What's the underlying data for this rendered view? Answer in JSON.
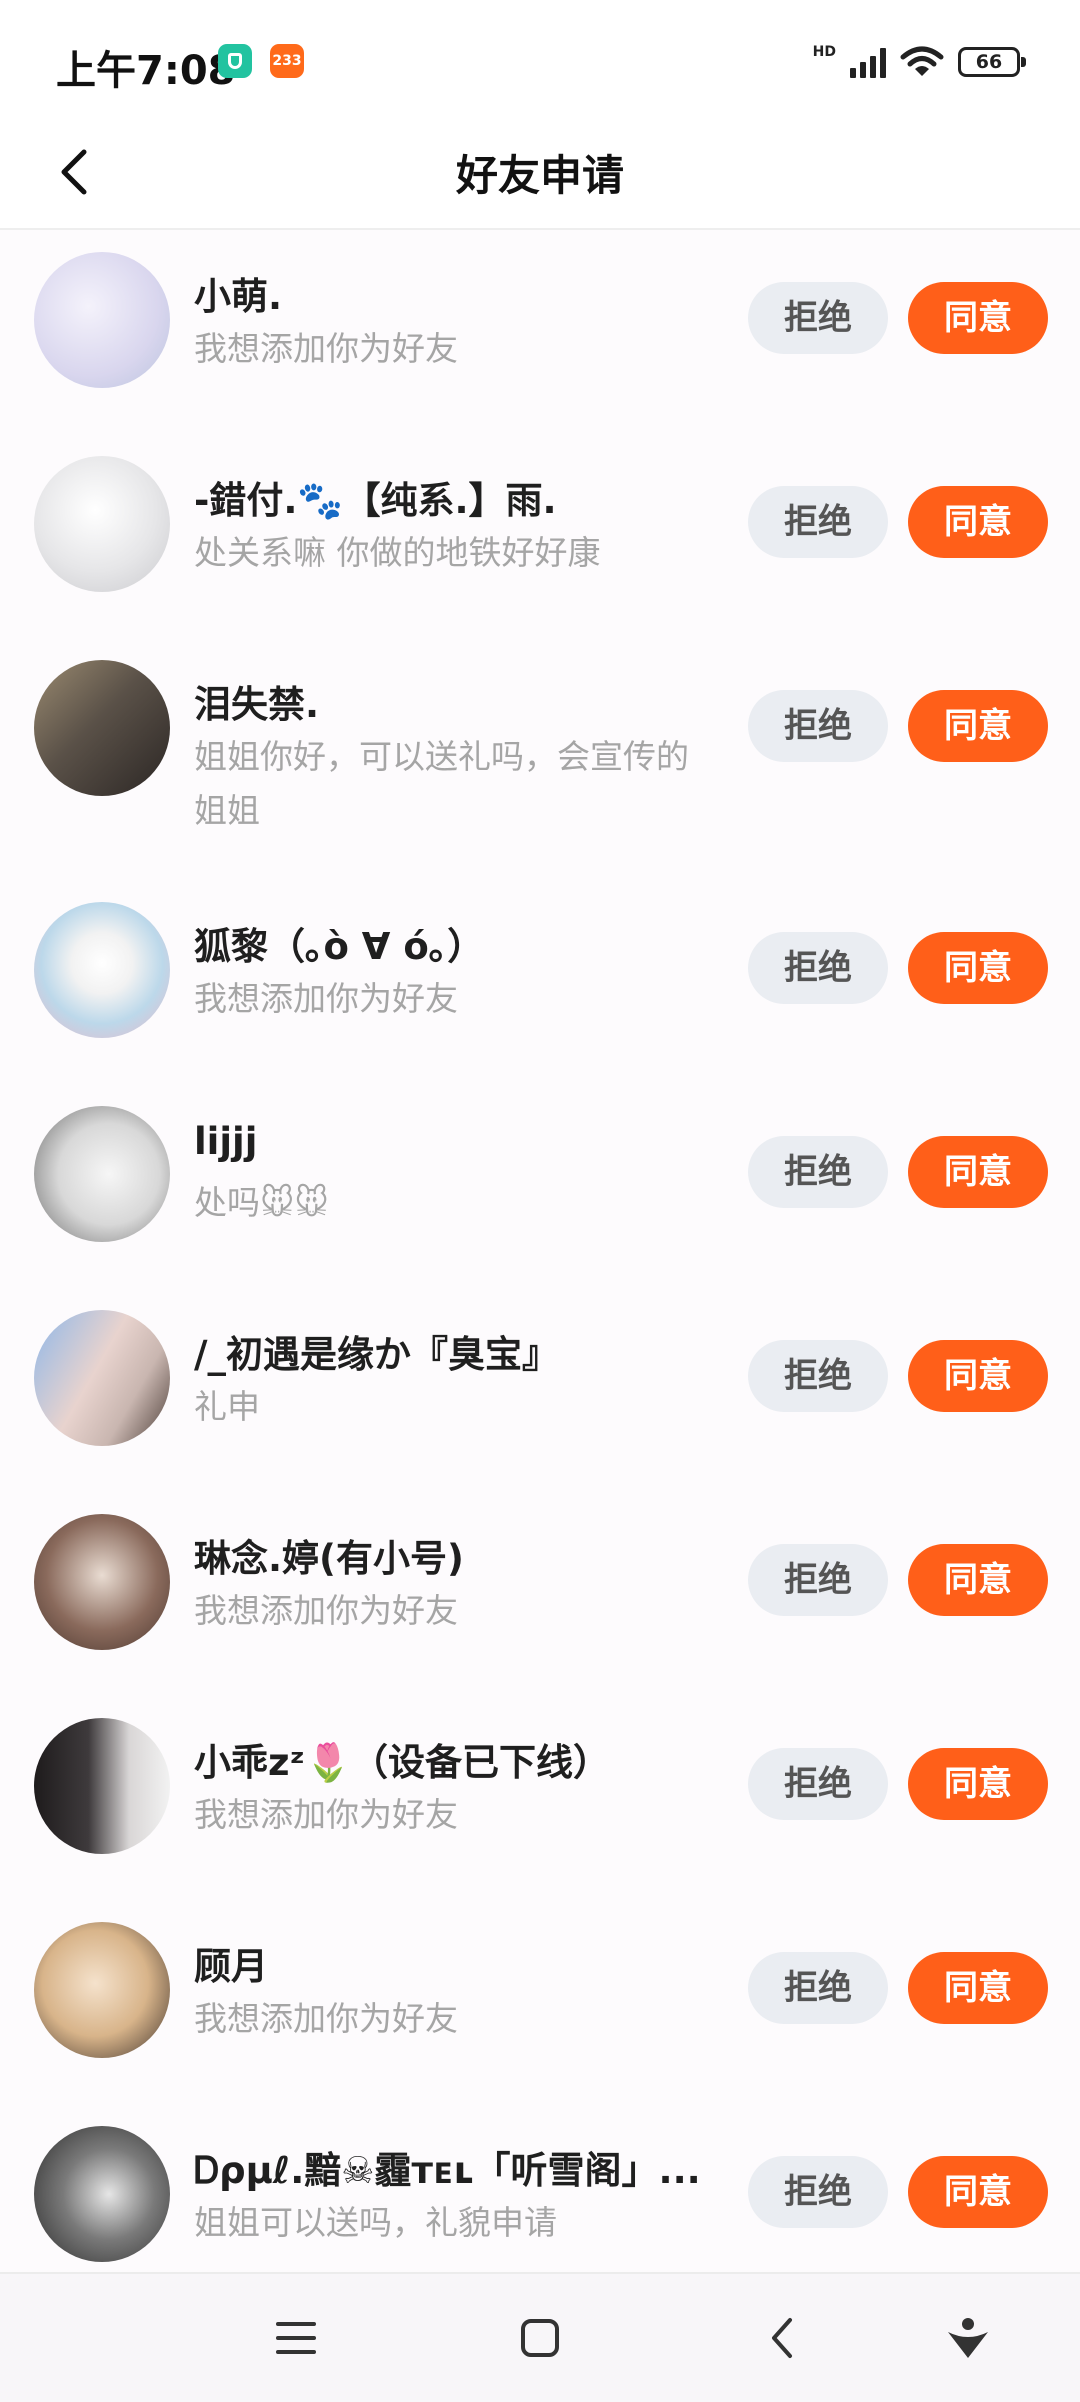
{
  "status_bar": {
    "time": "上午7:08",
    "badge_number": "233",
    "network": "HD",
    "battery": "66"
  },
  "header": {
    "title": "好友申请"
  },
  "buttons": {
    "reject": "拒绝",
    "accept": "同意"
  },
  "requests": [
    {
      "name": "小萌.",
      "message": "我想添加你为好友",
      "avatar_color": "#d9d6ee"
    },
    {
      "name": "-錯付.🐾【纯系.】雨.",
      "message": "处关系嘛 你做的地铁好好康",
      "avatar_color": "#e6e6e8"
    },
    {
      "name": "泪失禁.",
      "message": "姐姐你好，可以送礼吗，会宣传的姐姐",
      "avatar_color": "#5a5148"
    },
    {
      "name": "狐黎（｡ò ∀ ó｡）",
      "message": "我想添加你为好友",
      "avatar_color": "#bcd8ea"
    },
    {
      "name": "lijjj",
      "message": "处吗🐭🐭",
      "avatar_color": "#d8d8d8"
    },
    {
      "name": "/_初遇是缘か『臭宝』",
      "message": "礼申",
      "avatar_color": "#c9b6b0"
    },
    {
      "name": "琳念.婷(有小号)",
      "message": "我想添加你为好友",
      "avatar_color": "#8a6a5c"
    },
    {
      "name": "小乖zᶻ🌷（设备已下线）",
      "message": "我想添加你为好友",
      "avatar_color": "#3e3a3c"
    },
    {
      "name": "顾月",
      "message": "我想添加你为好友",
      "avatar_color": "#d8b48a"
    },
    {
      "name": "Ꭰρμℓ.黯☠霾ᴛᴇʟ「听雪阁」...",
      "message": "姐姐可以送吗，礼貌申请",
      "avatar_color": "#2a2a2a"
    }
  ],
  "colors": {
    "accent": "#ff5f19",
    "reject_bg": "#eaedf2",
    "secondary_text": "#a5a5a5"
  }
}
